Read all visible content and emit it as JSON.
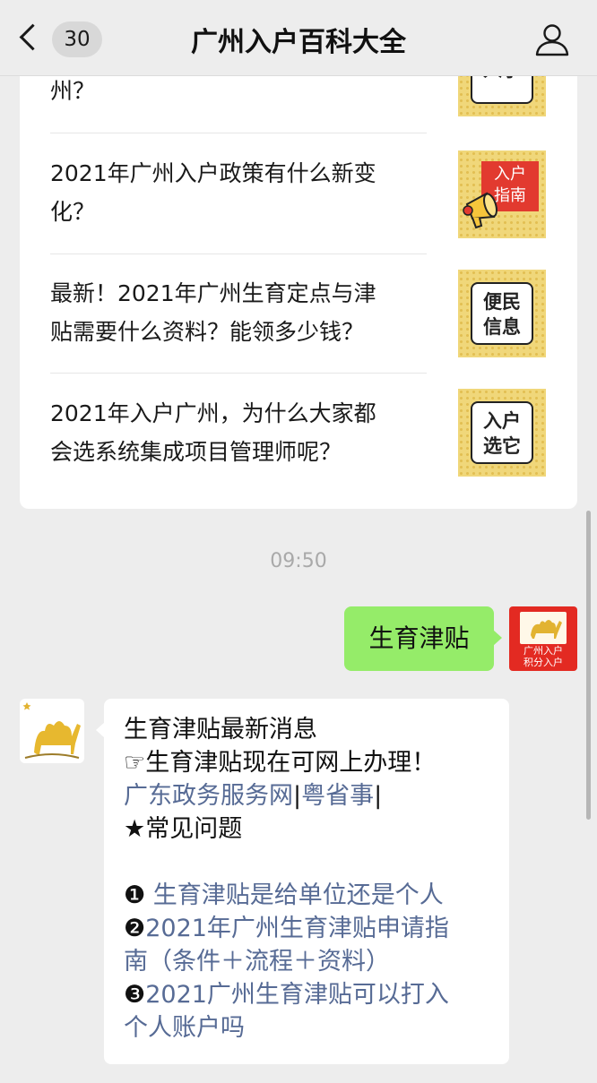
{
  "nav": {
    "unread_count": "30",
    "title": "广州入户百科大全"
  },
  "articles": [
    {
      "title_lines": [
        "州？"
      ],
      "thumb_text": [
        "入学"
      ],
      "thumb_style": "box"
    },
    {
      "title_lines": [
        "2021年广州入户政策有什么新变",
        "化？"
      ],
      "thumb_text": [
        "入户",
        "指南"
      ],
      "thumb_style": "red-megaphone"
    },
    {
      "title_lines": [
        "最新！2021年广州生育定点与津",
        "贴需要什么资料？能领多少钱？"
      ],
      "thumb_text": [
        "便民",
        "信息"
      ],
      "thumb_style": "box"
    },
    {
      "title_lines": [
        "2021年入户广州，为什么大家都",
        "会选系统集成项目管理师呢？"
      ],
      "thumb_text": [
        "入户",
        "选它"
      ],
      "thumb_style": "box"
    }
  ],
  "timestamp": "09:50",
  "sent_message": "生育津贴",
  "user_avatar": {
    "line1": "广州入户",
    "line2": "积分入户"
  },
  "reply": {
    "heading": "生育津贴最新消息",
    "online_prefix": "☞",
    "online_text": "生育津贴现在可网上办理！",
    "link_gd": "广东政务服务网",
    "sep1": "|",
    "link_yss": "粤省事",
    "sep2": "|",
    "faq_title": "★常见问题",
    "q1_marker": "❶",
    "q1_text": " 生育津贴是给单位还是个人",
    "q2_marker": "❷",
    "q2_line1": "2021年广州生育津贴申请指",
    "q2_line2": "南（条件＋流程＋资料）",
    "q3_marker": "❸",
    "q3_line1": "2021广州生育津贴可以打入",
    "q3_line2": "个人账户吗"
  },
  "colors": {
    "sent_bubble": "#95ec69",
    "link": "#576b95",
    "thumb_bg": "#f0d77a",
    "avatar_red": "#e32a22"
  }
}
